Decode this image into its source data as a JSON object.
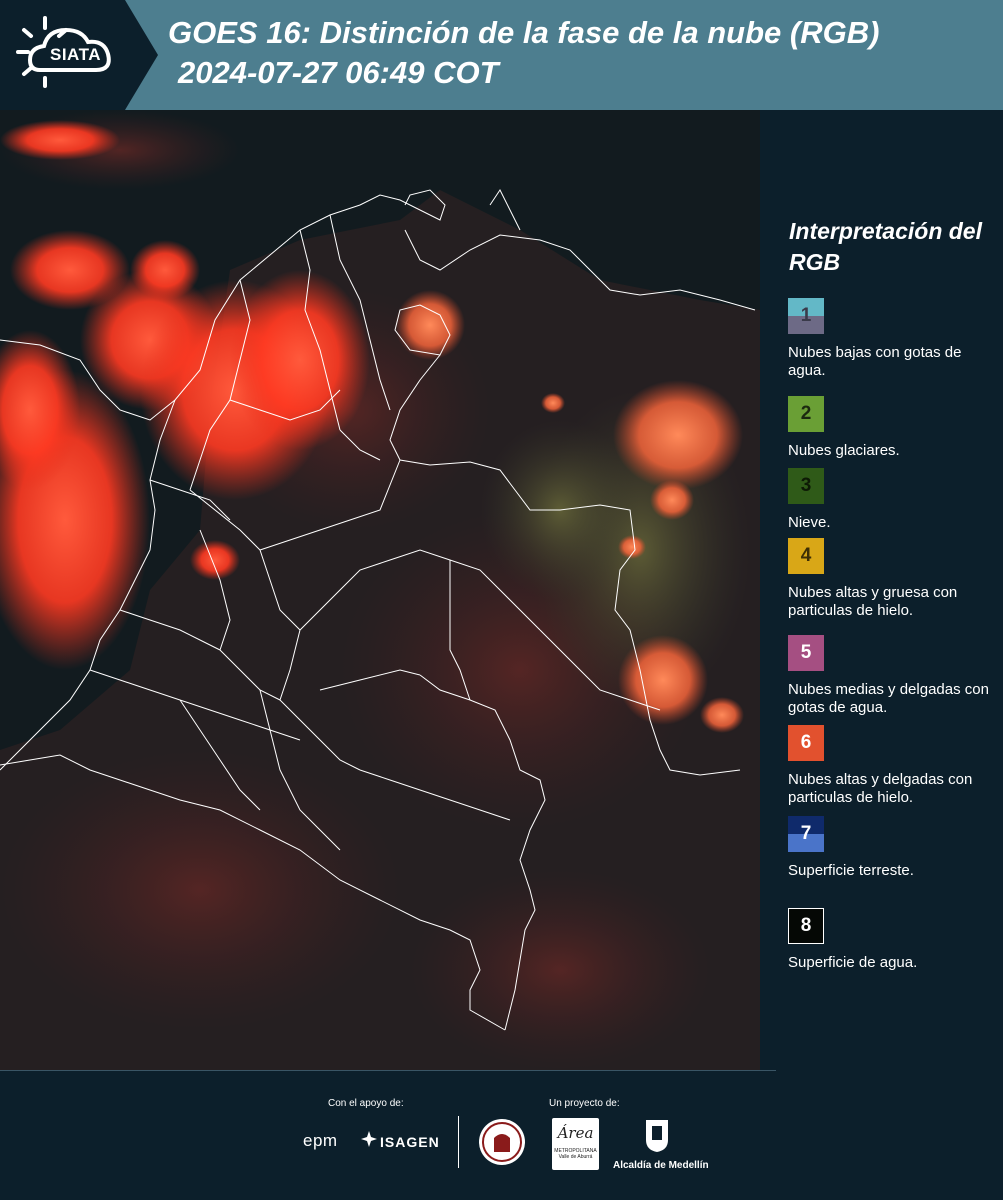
{
  "header": {
    "logo_text": "SIATA",
    "title": "GOES 16: Distinción de la fase de la nube (RGB)",
    "subtitle": "2024-07-27 06:49 COT"
  },
  "legend": {
    "title": "Interpretación del RGB",
    "items": [
      {
        "number": "1",
        "label": "Nubes bajas con gotas de agua.",
        "color_top": "#63b8c7",
        "color_bottom": "#6d6a86",
        "text_color": "#3a3a4a"
      },
      {
        "number": "2",
        "label": "Nubes glaciares.",
        "color_top": "#6a9f35",
        "color_bottom": "#6a9f35",
        "text_color": "#1c2a10"
      },
      {
        "number": "3",
        "label": "Nieve.",
        "color_top": "#2f5a18",
        "color_bottom": "#2f5a18",
        "text_color": "#0d1a05"
      },
      {
        "number": "4",
        "label": "Nubes altas y gruesa con particulas de hielo.",
        "color_top": "#d9a717",
        "color_bottom": "#d9a717",
        "text_color": "#3d2e05"
      },
      {
        "number": "5",
        "label": "Nubes medias y delgadas con gotas de agua.",
        "color_top": "#a54f82",
        "color_bottom": "#a54f82",
        "text_color": "#ffffff"
      },
      {
        "number": "6",
        "label": "Nubes altas y delgadas con particulas de hielo.",
        "color_top": "#e2512e",
        "color_bottom": "#e2512e",
        "text_color": "#ffffff"
      },
      {
        "number": "7",
        "label": "Superficie terreste.",
        "color_top": "#0f2a6b",
        "color_bottom": "#4a74c9",
        "text_color": "#ffffff"
      },
      {
        "number": "8",
        "label": "Superficie de agua.",
        "color_top": "#050805",
        "color_bottom": "#050805",
        "text_color": "#ffffff"
      }
    ]
  },
  "footer": {
    "support_label": "Con el apoyo de:",
    "project_label": "Un proyecto de:",
    "sponsor_1": "epm",
    "sponsor_2": "ISAGEN",
    "partner_area": "Área",
    "partner_area_sub": "METROPOLITANA Valle de Aburrá",
    "partner_alcaldia": "Alcaldía de Medellín"
  },
  "map": {
    "cloud_color": "#ff3b22",
    "border_color": "#ffffff",
    "ocean_color": "#0f1a1e",
    "land_color": "#2a2527"
  }
}
